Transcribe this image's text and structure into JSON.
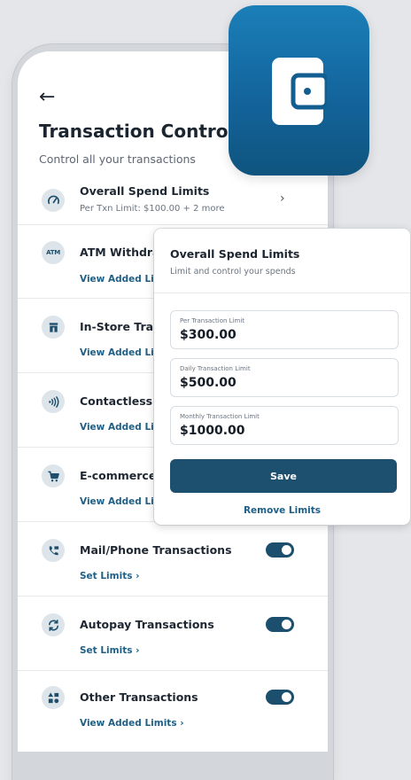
{
  "screen": {
    "back_icon": "←",
    "title": "Transaction Controls",
    "subtitle": "Control all your transactions"
  },
  "list": {
    "overall": {
      "label": "Overall Spend Limits",
      "detail": "Per Txn Limit: $100.00 + 2 more",
      "chevron": "›"
    },
    "atm": {
      "label": "ATM Withdrav",
      "icon_text": "ATM",
      "link": "View Added Lim"
    },
    "instore": {
      "label": "In-Store Trans",
      "link": "View Added Lim"
    },
    "contactless": {
      "label": "Contactless T",
      "link": "View Added Lim"
    },
    "ecommerce": {
      "label": "E-commerce",
      "link": "View Added Lim"
    },
    "mailphone": {
      "label": "Mail/Phone Transactions",
      "link": "Set Limits  ›",
      "enabled": true
    },
    "autopay": {
      "label": "Autopay Transactions",
      "link": "Set Limits  ›",
      "enabled": true
    },
    "other": {
      "label": "Other Transactions",
      "link": "View Added Limits  ›",
      "enabled": true
    }
  },
  "modal": {
    "title": "Overall Spend Limits",
    "subtitle": "Limit and control your spends",
    "fields": [
      {
        "label": "Per Transaction Limit",
        "value": "$300.00"
      },
      {
        "label": "Daily Transaction Limit",
        "value": "$500.00"
      },
      {
        "label": "Monthly Transaction Limit",
        "value": "$1000.00"
      }
    ],
    "save_label": "Save",
    "remove_label": "Remove Limits"
  },
  "colors": {
    "accent": "#1d4f6e",
    "link": "#1f5f86",
    "app_icon_top": "#1b7fb8",
    "app_icon_bottom": "#0f547e"
  }
}
